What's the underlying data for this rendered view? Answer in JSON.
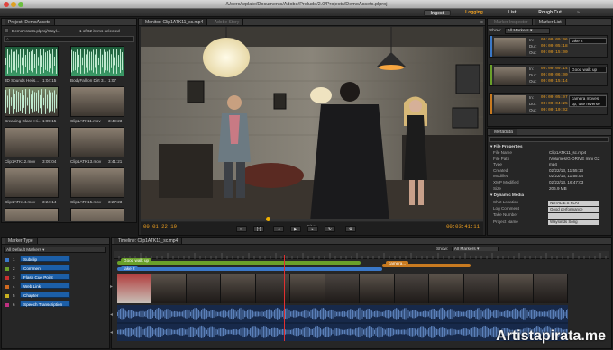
{
  "window": {
    "title": "/Users/wplate/Documents/Adobe/Prelude/2.0/Projects/DemoAssets.plproj"
  },
  "workspaces": {
    "ingest": "Ingest",
    "logging": "Logging",
    "list": "List",
    "rough_cut": "Rough Cut"
  },
  "project": {
    "tab": "Project: DemoAssets",
    "path": "DemoAssets.plproj/Wayl...",
    "count": "1 of 62 items selected",
    "clips": [
      {
        "name": "3D Sounds Helis...",
        "dur": "1:04:15"
      },
      {
        "name": "BodyFall on Dirt 3...",
        "dur": "1:07"
      },
      {
        "name": "Breaking Glass Hi...",
        "dur": "1:05:15"
      },
      {
        "name": "Clip1ATK11.mov",
        "dur": "3:49:23"
      },
      {
        "name": "Clip1ATK12.mov",
        "dur": "3:05:04"
      },
      {
        "name": "Clip1ATK13.mov",
        "dur": "3:41:21"
      },
      {
        "name": "Clip1ATK14.mov",
        "dur": "3:24:14"
      },
      {
        "name": "Clip1ATK15.mov",
        "dur": "3:27:23"
      },
      {
        "name": "Clip1ATK16.mov",
        "dur": "3:56:14"
      },
      {
        "name": "Clip1ATK17.mov",
        "dur": "3:15:14"
      },
      {
        "name": "",
        "dur": ""
      },
      {
        "name": "",
        "dur": ""
      }
    ]
  },
  "monitor": {
    "tab": "Monitor: Clip1ATK11_sc.mp4",
    "tab2": "Adobe Story",
    "tc_current": "00:01:22:19",
    "tc_total": "00:03:41:11",
    "zoom": "Fit",
    "playhead_fraction": 0.37
  },
  "markers_panel": {
    "tab": "Marker Inspector",
    "tab2": "Marker List",
    "show_label": "Show:",
    "show_value": "All Markers",
    "items": [
      {
        "in": "00:00:09:06",
        "dur": "00:00:05:18",
        "out": "00:00:15:00",
        "comment": "take 2",
        "color": "#3a78c8"
      },
      {
        "in": "00:00:09:14",
        "dur": "00:00:06:00",
        "out": "00:00:15:14",
        "comment": "Good walk up",
        "color": "#6aa02a"
      },
      {
        "in": "00:00:05:07",
        "dur": "00:00:04:25",
        "out": "00:00:10:02",
        "comment": "camera moves up, use reverse",
        "color": "#c87a20"
      }
    ],
    "in_label": "In:",
    "dur_label": "Dur:",
    "out_label": "Out:"
  },
  "metadata": {
    "tab": "Metadata",
    "file_props": "File Properties",
    "rows": [
      {
        "label": "File Name",
        "value": "Clip1ATK11_sc.mp4"
      },
      {
        "label": "File Path",
        "value": "/Volumes/G-DRIVE mini G2"
      },
      {
        "label": "Type",
        "value": "mp4"
      },
      {
        "label": "Created",
        "value": "02/22/13, 11:55:13"
      },
      {
        "label": "Modified",
        "value": "02/22/13, 11:55:04"
      },
      {
        "label": "XMP Modified",
        "value": "02/22/13, 16:47:03"
      },
      {
        "label": "Size",
        "value": "206.9 MB"
      }
    ],
    "dyn_media": "Dynamic Media",
    "dyn_rows": [
      {
        "label": "Shot Location",
        "value": "NATALIE'S FLAT"
      },
      {
        "label": "Log Comment",
        "value": "Good performance"
      },
      {
        "label": "Take Number",
        "value": ""
      },
      {
        "label": "Project Name",
        "value": "Waylonds Song"
      }
    ]
  },
  "marker_type": {
    "tab": "Marker Type",
    "set": "All Default Markers",
    "items": [
      {
        "num": "1",
        "label": "Subclip",
        "color": "#3a78c8"
      },
      {
        "num": "2",
        "label": "Comment",
        "color": "#6aa02a"
      },
      {
        "num": "3",
        "label": "Flash Cue Point",
        "color": "#c83030"
      },
      {
        "num": "4",
        "label": "Web Link",
        "color": "#d06a20"
      },
      {
        "num": "5",
        "label": "Chapter",
        "color": "#c8b020"
      },
      {
        "num": "6",
        "label": "Speech Transcription",
        "color": "#c03080"
      }
    ]
  },
  "timeline": {
    "tab": "Timeline: Clip1ATK11_sc.mp4",
    "show_label": "Show:",
    "show_value": "All Markers",
    "markers": [
      {
        "label": "Good walk up",
        "start": 0.0,
        "end": 0.55,
        "color": "#6aa02a"
      },
      {
        "label": "take 2",
        "start": 0.0,
        "end": 0.6,
        "color": "#3a78c8"
      },
      {
        "label": "camera...",
        "start": 0.6,
        "end": 0.8,
        "color": "#c87a20"
      }
    ],
    "playhead_fraction": 0.37
  },
  "watermark": "Artistapirata.me"
}
